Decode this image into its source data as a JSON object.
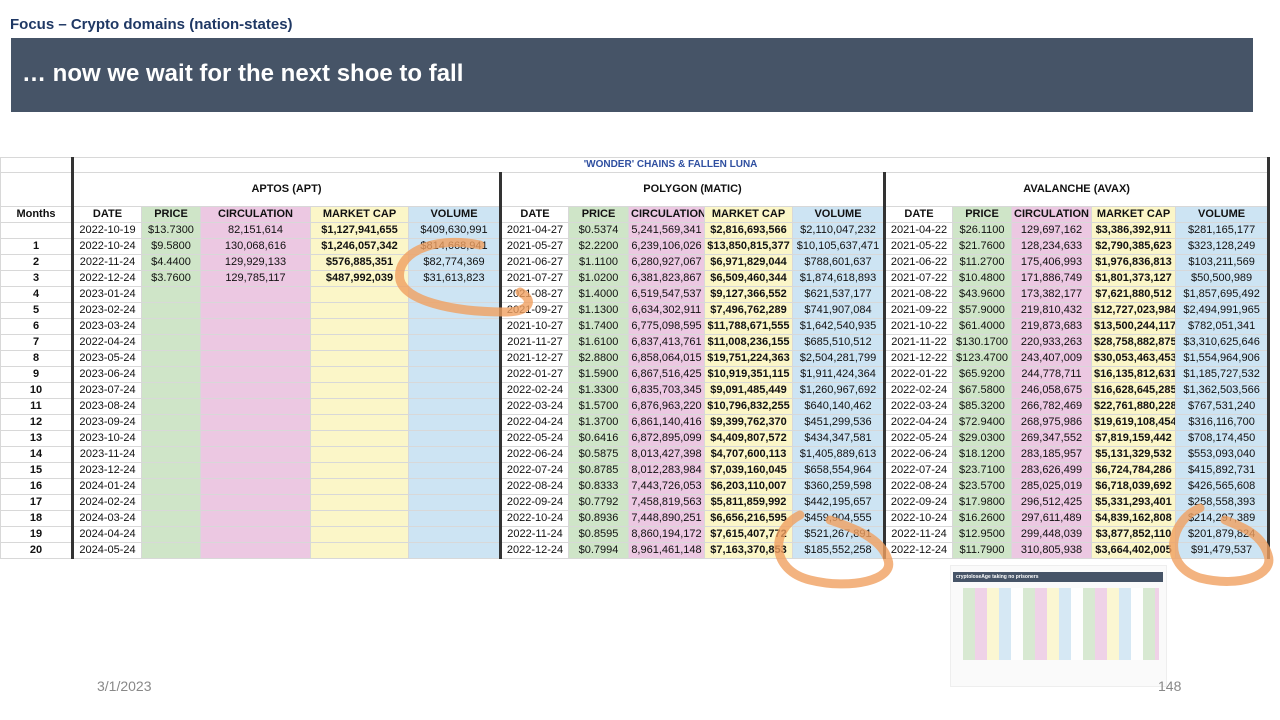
{
  "header": {
    "focus": "Focus – Crypto domains (nation-states)",
    "title": "… now we wait for the next shoe to fall"
  },
  "table": {
    "super_title": "'WONDER' CHAINS & FALLEN LUNA",
    "months_label": "Months",
    "columns": [
      "DATE",
      "PRICE",
      "CIRCULATION",
      "MARKET CAP",
      "VOLUME"
    ],
    "months": [
      "",
      "1",
      "2",
      "3",
      "4",
      "5",
      "6",
      "7",
      "8",
      "9",
      "10",
      "11",
      "12",
      "13",
      "14",
      "15",
      "16",
      "17",
      "18",
      "19",
      "20"
    ],
    "chains": [
      {
        "name": "APTOS (APT)",
        "rows": [
          [
            "2022-10-19",
            "$13.7300",
            "82,151,614",
            "$1,127,941,655",
            "$409,630,991"
          ],
          [
            "2022-10-24",
            "$9.5800",
            "130,068,616",
            "$1,246,057,342",
            "$814,668,941"
          ],
          [
            "2022-11-24",
            "$4.4400",
            "129,929,133",
            "$576,885,351",
            "$82,774,369"
          ],
          [
            "2022-12-24",
            "$3.7600",
            "129,785,117",
            "$487,992,039",
            "$31,613,823"
          ],
          [
            "2023-01-24",
            "",
            "",
            "",
            ""
          ],
          [
            "2023-02-24",
            "",
            "",
            "",
            ""
          ],
          [
            "2023-03-24",
            "",
            "",
            "",
            ""
          ],
          [
            "2022-04-24",
            "",
            "",
            "",
            ""
          ],
          [
            "2023-05-24",
            "",
            "",
            "",
            ""
          ],
          [
            "2023-06-24",
            "",
            "",
            "",
            ""
          ],
          [
            "2023-07-24",
            "",
            "",
            "",
            ""
          ],
          [
            "2023-08-24",
            "",
            "",
            "",
            ""
          ],
          [
            "2023-09-24",
            "",
            "",
            "",
            ""
          ],
          [
            "2023-10-24",
            "",
            "",
            "",
            ""
          ],
          [
            "2023-11-24",
            "",
            "",
            "",
            ""
          ],
          [
            "2023-12-24",
            "",
            "",
            "",
            ""
          ],
          [
            "2024-01-24",
            "",
            "",
            "",
            ""
          ],
          [
            "2024-02-24",
            "",
            "",
            "",
            ""
          ],
          [
            "2024-03-24",
            "",
            "",
            "",
            ""
          ],
          [
            "2024-04-24",
            "",
            "",
            "",
            ""
          ],
          [
            "2024-05-24",
            "",
            "",
            "",
            ""
          ]
        ]
      },
      {
        "name": "POLYGON (MATIC)",
        "rows": [
          [
            "2021-04-27",
            "$0.5374",
            "5,241,569,341",
            "$2,816,693,566",
            "$2,110,047,232"
          ],
          [
            "2021-05-27",
            "$2.2200",
            "6,239,106,026",
            "$13,850,815,377",
            "$10,105,637,471"
          ],
          [
            "2021-06-27",
            "$1.1100",
            "6,280,927,067",
            "$6,971,829,044",
            "$788,601,637"
          ],
          [
            "2021-07-27",
            "$1.0200",
            "6,381,823,867",
            "$6,509,460,344",
            "$1,874,618,893"
          ],
          [
            "2021-08-27",
            "$1.4000",
            "6,519,547,537",
            "$9,127,366,552",
            "$621,537,177"
          ],
          [
            "2021-09-27",
            "$1.1300",
            "6,634,302,911",
            "$7,496,762,289",
            "$741,907,084"
          ],
          [
            "2021-10-27",
            "$1.7400",
            "6,775,098,595",
            "$11,788,671,555",
            "$1,642,540,935"
          ],
          [
            "2021-11-27",
            "$1.6100",
            "6,837,413,761",
            "$11,008,236,155",
            "$685,510,512"
          ],
          [
            "2021-12-27",
            "$2.8800",
            "6,858,064,015",
            "$19,751,224,363",
            "$2,504,281,799"
          ],
          [
            "2022-01-27",
            "$1.5900",
            "6,867,516,425",
            "$10,919,351,115",
            "$1,911,424,364"
          ],
          [
            "2022-02-24",
            "$1.3300",
            "6,835,703,345",
            "$9,091,485,449",
            "$1,260,967,692"
          ],
          [
            "2022-03-24",
            "$1.5700",
            "6,876,963,220",
            "$10,796,832,255",
            "$640,140,462"
          ],
          [
            "2022-04-24",
            "$1.3700",
            "6,861,140,416",
            "$9,399,762,370",
            "$451,299,536"
          ],
          [
            "2022-05-24",
            "$0.6416",
            "6,872,895,099",
            "$4,409,807,572",
            "$434,347,581"
          ],
          [
            "2022-06-24",
            "$0.5875",
            "8,013,427,398",
            "$4,707,600,113",
            "$1,405,889,613"
          ],
          [
            "2022-07-24",
            "$0.8785",
            "8,012,283,984",
            "$7,039,160,045",
            "$658,554,964"
          ],
          [
            "2022-08-24",
            "$0.8333",
            "7,443,726,053",
            "$6,203,110,007",
            "$360,259,598"
          ],
          [
            "2022-09-24",
            "$0.7792",
            "7,458,819,563",
            "$5,811,859,992",
            "$442,195,657"
          ],
          [
            "2022-10-24",
            "$0.8936",
            "7,448,890,251",
            "$6,656,216,595",
            "$459,904,555"
          ],
          [
            "2022-11-24",
            "$0.8595",
            "8,860,194,172",
            "$7,615,407,772",
            "$521,267,891"
          ],
          [
            "2022-12-24",
            "$0.7994",
            "8,961,461,148",
            "$7,163,370,853",
            "$185,552,258"
          ]
        ]
      },
      {
        "name": "AVALANCHE (AVAX)",
        "rows": [
          [
            "2021-04-22",
            "$26.1100",
            "129,697,162",
            "$3,386,392,911",
            "$281,165,177"
          ],
          [
            "2021-05-22",
            "$21.7600",
            "128,234,633",
            "$2,790,385,623",
            "$323,128,249"
          ],
          [
            "2021-06-22",
            "$11.2700",
            "175,406,993",
            "$1,976,836,813",
            "$103,211,569"
          ],
          [
            "2021-07-22",
            "$10.4800",
            "171,886,749",
            "$1,801,373,127",
            "$50,500,989"
          ],
          [
            "2021-08-22",
            "$43.9600",
            "173,382,177",
            "$7,621,880,512",
            "$1,857,695,492"
          ],
          [
            "2021-09-22",
            "$57.9000",
            "219,810,432",
            "$12,727,023,984",
            "$2,494,991,965"
          ],
          [
            "2021-10-22",
            "$61.4000",
            "219,873,683",
            "$13,500,244,117",
            "$782,051,341"
          ],
          [
            "2021-11-22",
            "$130.1700",
            "220,933,263",
            "$28,758,882,875",
            "$3,310,625,646"
          ],
          [
            "2021-12-22",
            "$123.4700",
            "243,407,009",
            "$30,053,463,453",
            "$1,554,964,906"
          ],
          [
            "2022-01-22",
            "$65.9200",
            "244,778,711",
            "$16,135,812,631",
            "$1,185,727,532"
          ],
          [
            "2022-02-24",
            "$67.5800",
            "246,058,675",
            "$16,628,645,285",
            "$1,362,503,566"
          ],
          [
            "2022-03-24",
            "$85.3200",
            "266,782,469",
            "$22,761,880,228",
            "$767,531,240"
          ],
          [
            "2022-04-24",
            "$72.9400",
            "268,975,986",
            "$19,619,108,454",
            "$316,116,700"
          ],
          [
            "2022-05-24",
            "$29.0300",
            "269,347,552",
            "$7,819,159,442",
            "$708,174,450"
          ],
          [
            "2022-06-24",
            "$18.1200",
            "283,185,957",
            "$5,131,329,532",
            "$553,093,040"
          ],
          [
            "2022-07-24",
            "$23.7100",
            "283,626,499",
            "$6,724,784,286",
            "$415,892,731"
          ],
          [
            "2022-08-24",
            "$23.5700",
            "285,025,019",
            "$6,718,039,692",
            "$426,565,608"
          ],
          [
            "2022-09-24",
            "$17.9800",
            "296,512,425",
            "$5,331,293,401",
            "$258,558,393"
          ],
          [
            "2022-10-24",
            "$16.2600",
            "297,611,489",
            "$4,839,162,808",
            "$214,297,389"
          ],
          [
            "2022-11-24",
            "$12.9500",
            "299,448,039",
            "$3,877,852,110",
            "$201,879,824"
          ],
          [
            "2022-12-24",
            "$11.7900",
            "310,805,938",
            "$3,664,402,005",
            "$91,479,537"
          ]
        ]
      }
    ]
  },
  "thumbnail": {
    "title": "cryptoloseAge taking no prisoners"
  },
  "footer": {
    "date": "3/1/2023",
    "page": "148"
  },
  "colors": {
    "banner": "#465467",
    "focus": "#1f3864",
    "annotation": "#f0a060"
  }
}
